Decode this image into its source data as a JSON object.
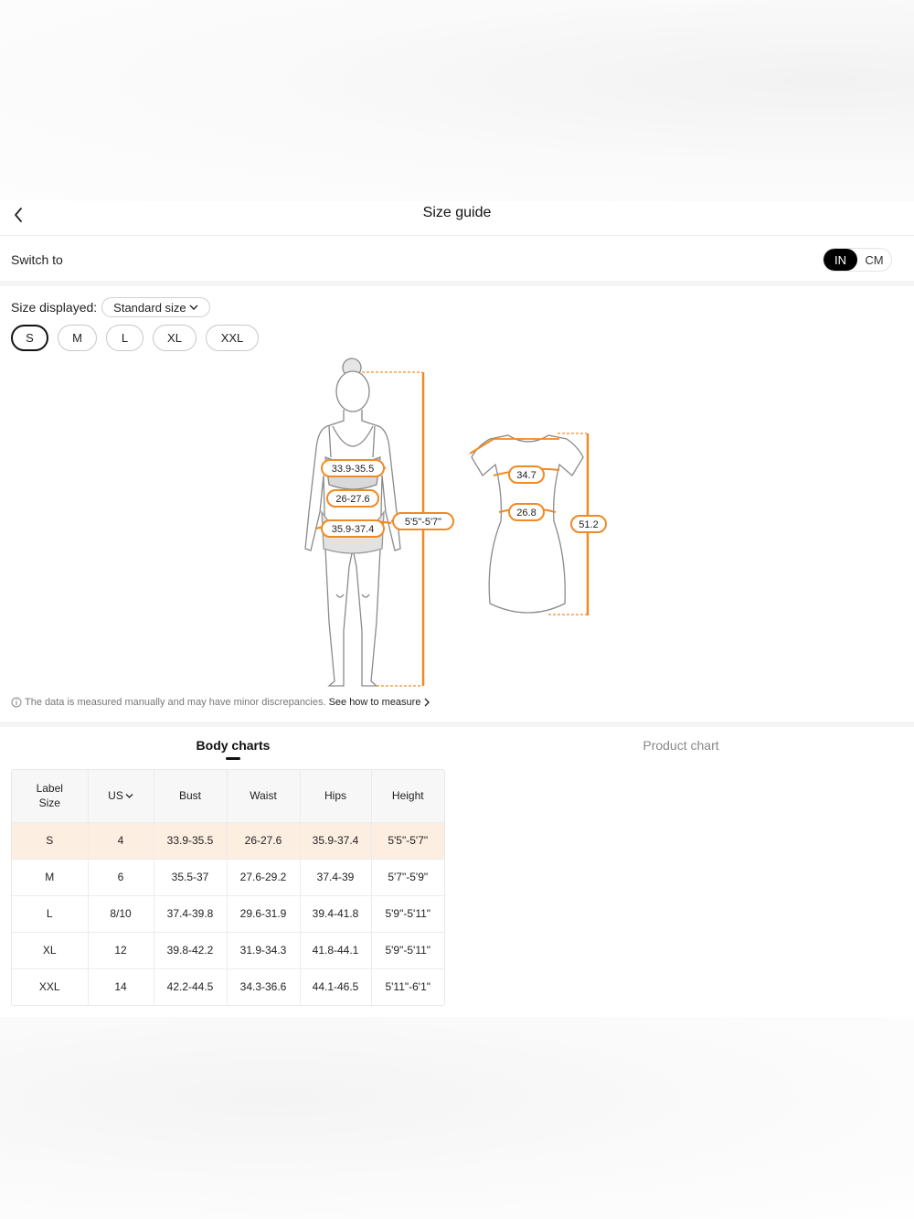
{
  "header": {
    "title": "Size guide"
  },
  "switch": {
    "label": "Switch to",
    "units": [
      "IN",
      "CM"
    ],
    "active": "IN"
  },
  "size_display": {
    "label": "Size displayed:",
    "selected": "Standard size"
  },
  "sizes": [
    "S",
    "M",
    "L",
    "XL",
    "XXL"
  ],
  "selected_size": "S",
  "illustration": {
    "body": {
      "bust": "33.9-35.5",
      "waist": "26-27.6",
      "hips": "35.9-37.4",
      "height": "5'5\"-5'7\""
    },
    "dress": {
      "bust": "34.7",
      "waist": "26.8",
      "length": "51.2"
    }
  },
  "disclaimer": {
    "text": "The data is measured manually and may have minor discrepancies.",
    "link": "See how to measure"
  },
  "tabs": [
    {
      "label": "Body charts",
      "active": true
    },
    {
      "label": "Product chart",
      "active": false
    }
  ],
  "table": {
    "headers": [
      "Label Size",
      "US",
      "Bust",
      "Waist",
      "Hips",
      "Height"
    ],
    "rows": [
      [
        "S",
        "4",
        "33.9-35.5",
        "26-27.6",
        "35.9-37.4",
        "5'5\"-5'7\""
      ],
      [
        "M",
        "6",
        "35.5-37",
        "27.6-29.2",
        "37.4-39",
        "5'7\"-5'9\""
      ],
      [
        "L",
        "8/10",
        "37.4-39.8",
        "29.6-31.9",
        "39.4-41.8",
        "5'9\"-5'11\""
      ],
      [
        "XL",
        "12",
        "39.8-42.2",
        "31.9-34.3",
        "41.8-44.1",
        "5'9\"-5'11\""
      ],
      [
        "XXL",
        "14",
        "42.2-44.5",
        "34.3-36.6",
        "44.1-46.5",
        "5'11\"-6'1\""
      ]
    ]
  },
  "colors": {
    "accent": "#f08a24",
    "highlight_row": "#fdeee2",
    "active_toggle": "#000000"
  }
}
